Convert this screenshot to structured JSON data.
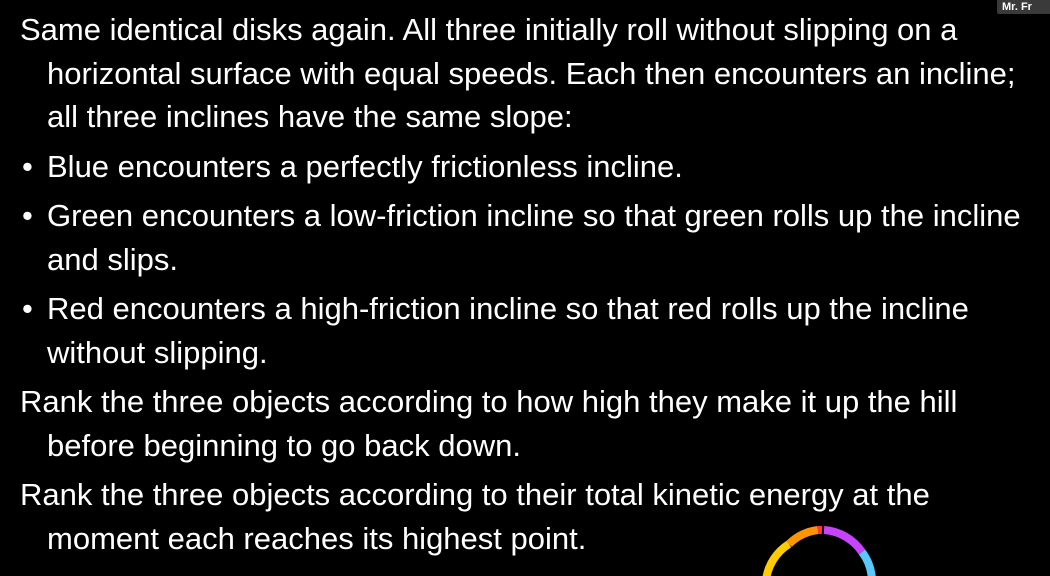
{
  "user_tag": {
    "label": "Mr. Fr"
  },
  "paragraphs": {
    "intro": "Same identical disks again.  All three initially roll without slipping on a horizontal surface with equal speeds.  Each then encounters an incline; all three inclines have the same slope:",
    "bullets": [
      "Blue encounters a perfectly frictionless incline.",
      "Green encounters a low-friction incline so that green rolls up the incline and slips.",
      "Red encounters a high-friction incline so that red rolls up the incline without slipping."
    ],
    "question1": "Rank the three objects according to how high they make it up the hill before beginning to go back down.",
    "question2": "Rank the three objects according to their total kinetic energy at the moment each reaches its highest point."
  },
  "bullet_glyph": "•",
  "timer": {
    "icon": "countdown-timer-icon",
    "colors": [
      "#ff3b30",
      "#ff9500",
      "#ffcc00",
      "#c644fc",
      "#5ac8fa"
    ]
  }
}
